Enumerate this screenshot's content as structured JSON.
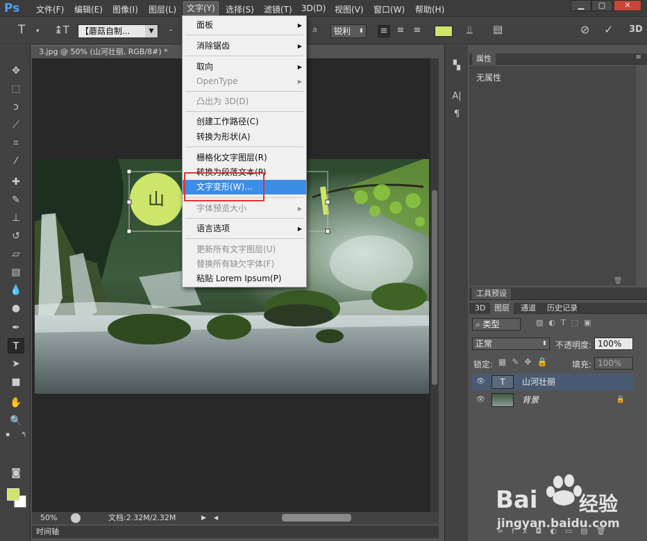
{
  "menubar": {
    "logo": "Ps",
    "items": [
      "文件(F)",
      "编辑(E)",
      "图像(I)",
      "图层(L)",
      "文字(Y)",
      "选择(S)",
      "滤镜(T)",
      "3D(D)",
      "视图(V)",
      "窗口(W)",
      "帮助(H)"
    ]
  },
  "options": {
    "font_name": "【蘑菇自制...",
    "aa_label": "a",
    "antialias": "锐利",
    "text_color": "#cde56a"
  },
  "document": {
    "tab_title": "3.jpg @ 50% (山河壮丽, RGB/8#) *",
    "zoom": "50%",
    "doc_size": "文档:2.32M/2.32M"
  },
  "timeline": "时间轴",
  "text_menu": {
    "items": [
      {
        "label": "面板",
        "submenu": true,
        "disabled": false
      },
      {
        "label": "消除锯齿",
        "submenu": true,
        "disabled": false
      },
      {
        "label": "取向",
        "submenu": true,
        "disabled": false
      },
      {
        "label": "OpenType",
        "submenu": true,
        "disabled": true
      },
      {
        "label": "凸出为 3D(D)",
        "submenu": false,
        "disabled": true
      },
      {
        "label": "创建工作路径(C)",
        "submenu": false,
        "disabled": false
      },
      {
        "label": "转换为形状(A)",
        "submenu": false,
        "disabled": false
      },
      {
        "label": "栅格化文字图层(R)",
        "submenu": false,
        "disabled": false
      },
      {
        "label": "转换为段落文本(P)",
        "submenu": false,
        "disabled": false
      },
      {
        "label": "文字变形(W)...",
        "submenu": false,
        "disabled": false,
        "highlighted": true
      },
      {
        "label": "字体预览大小",
        "submenu": true,
        "disabled": true
      },
      {
        "label": "语言选项",
        "submenu": true,
        "disabled": false
      },
      {
        "label": "更新所有文字图层(U)",
        "submenu": false,
        "disabled": true
      },
      {
        "label": "替换所有缺欠字体(F)",
        "submenu": false,
        "disabled": true
      },
      {
        "label": "粘贴 Lorem Ipsum(P)",
        "submenu": false,
        "disabled": false
      }
    ]
  },
  "properties": {
    "tab": "属性",
    "empty": "无属性"
  },
  "layers": {
    "tool_preset_tab": "工具预设",
    "tabs": [
      "3D",
      "图层",
      "通道",
      "历史记录"
    ],
    "filter_kind": "类型",
    "blend_mode": "正常",
    "opacity_label": "不透明度:",
    "opacity": "100%",
    "lock_label": "锁定:",
    "fill_label": "填充:",
    "fill": "100%",
    "rows": [
      {
        "name": "山河壮丽",
        "type": "text"
      },
      {
        "name": "背景",
        "type": "image"
      }
    ]
  },
  "watermark": {
    "brand": "Bai",
    "brand2": "经验",
    "url": "jingyan.baidu.com"
  }
}
